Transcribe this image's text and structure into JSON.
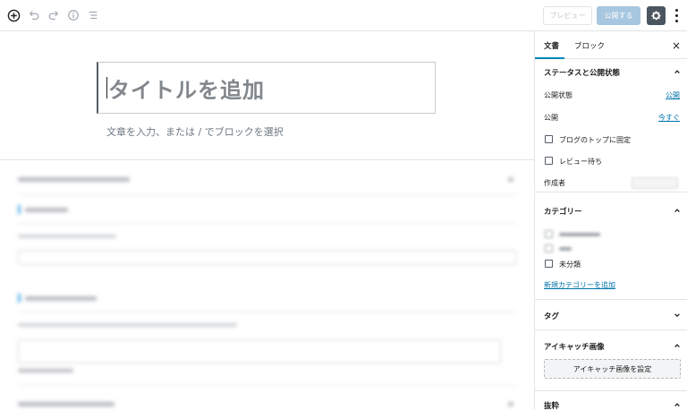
{
  "toolbar": {
    "add_icon": "plus-circle-icon",
    "undo_icon": "undo-icon",
    "redo_icon": "redo-icon",
    "info_icon": "info-icon",
    "outline_icon": "list-view-icon",
    "preview_label": "プレビュー",
    "publish_label": "公開する",
    "settings_icon": "gear-icon",
    "more_icon": "more-vertical-icon"
  },
  "editor": {
    "title_placeholder": "タイトルを追加",
    "block_hint": "文章を入力、または / でブロックを選択"
  },
  "sidebar": {
    "tabs": [
      {
        "label": "文書"
      },
      {
        "label": "ブロック"
      }
    ],
    "close_label": "×",
    "status_panel": {
      "title": "ステータスと公開状態",
      "visibility_label": "公開状態",
      "visibility_value": "公開",
      "publish_label": "公開",
      "publish_value": "今すぐ",
      "sticky_label": "ブログのトップに固定",
      "pending_label": "レビュー待ち",
      "author_label": "作成者"
    },
    "category_panel": {
      "title": "カテゴリー",
      "uncategorized_label": "未分類",
      "add_link": "新規カテゴリーを追加"
    },
    "tag_panel": {
      "title": "タグ"
    },
    "featured_panel": {
      "title": "アイキャッチ画像",
      "button_label": "アイキャッチ画像を設定"
    },
    "excerpt_panel": {
      "title": "抜粋"
    }
  },
  "colors": {
    "accent": "#0085ba",
    "link": "#0073aa",
    "publish_disabled": "#a7c6df",
    "gear_bg": "#4b5560"
  }
}
